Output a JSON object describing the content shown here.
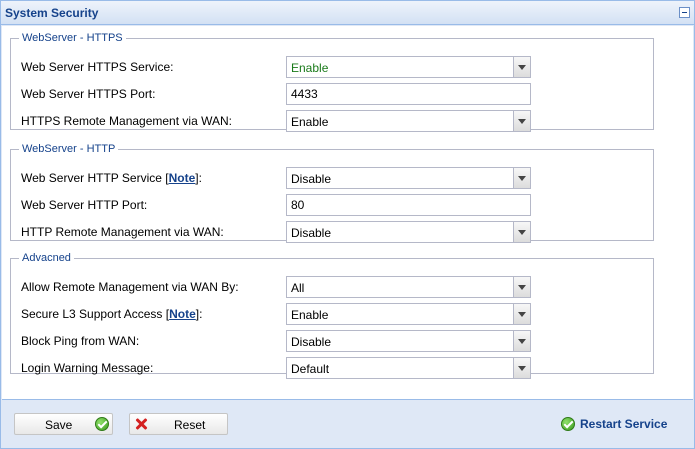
{
  "panel": {
    "title": "System Security"
  },
  "https": {
    "legend": "WebServer - HTTPS",
    "service_label": "Web Server HTTPS Service:",
    "service_value": "Enable",
    "port_label": "Web Server HTTPS Port:",
    "port_value": "4433",
    "remote_label": "HTTPS Remote Management via WAN:",
    "remote_value": "Enable"
  },
  "http": {
    "legend": "WebServer - HTTP",
    "service_label_pre": "Web Server HTTP Service [",
    "service_note": "Note",
    "service_label_post": "]:",
    "service_value": "Disable",
    "port_label": "Web Server HTTP Port:",
    "port_value": "80",
    "remote_label": "HTTP Remote Management via WAN:",
    "remote_value": "Disable"
  },
  "advanced": {
    "legend": "Advacned",
    "allow_label": "Allow Remote Management via WAN By:",
    "allow_value": "All",
    "secure_label_pre": "Secure L3 Support Access [",
    "secure_note": "Note",
    "secure_label_post": "]:",
    "secure_value": "Enable",
    "ping_label": "Block Ping from WAN:",
    "ping_value": "Disable",
    "warning_label": "Login Warning Message:",
    "warning_value": "Default"
  },
  "footer": {
    "save_label": "Save",
    "reset_label": "Reset",
    "restart_label": "Restart Service"
  },
  "icons": {
    "collapse": "collapse-icon",
    "ok": "check-circle-icon",
    "cancel": "red-x-icon",
    "dropdown": "chevron-down-icon"
  },
  "colors": {
    "title": "#15428b",
    "panel_border": "#99bbe8",
    "enabled_green": "#1a7a1a",
    "cancel_red": "#d42020"
  }
}
